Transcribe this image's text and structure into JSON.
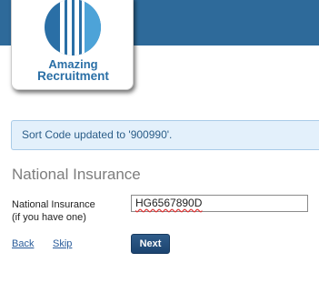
{
  "brand": {
    "line1": "Amazing",
    "line2": "Recruitment",
    "logo_colors": [
      "#2a6fa6",
      "#4da3d8"
    ],
    "header_color": "#2e6a9a"
  },
  "alert": {
    "message": "Sort Code updated to '900990'."
  },
  "section": {
    "title": "National Insurance"
  },
  "field": {
    "label_line1": "National Insurance",
    "label_line2": "(if you have one)",
    "value": "HG6567890D"
  },
  "actions": {
    "back_label": "Back",
    "skip_label": "Skip",
    "next_label": "Next"
  }
}
